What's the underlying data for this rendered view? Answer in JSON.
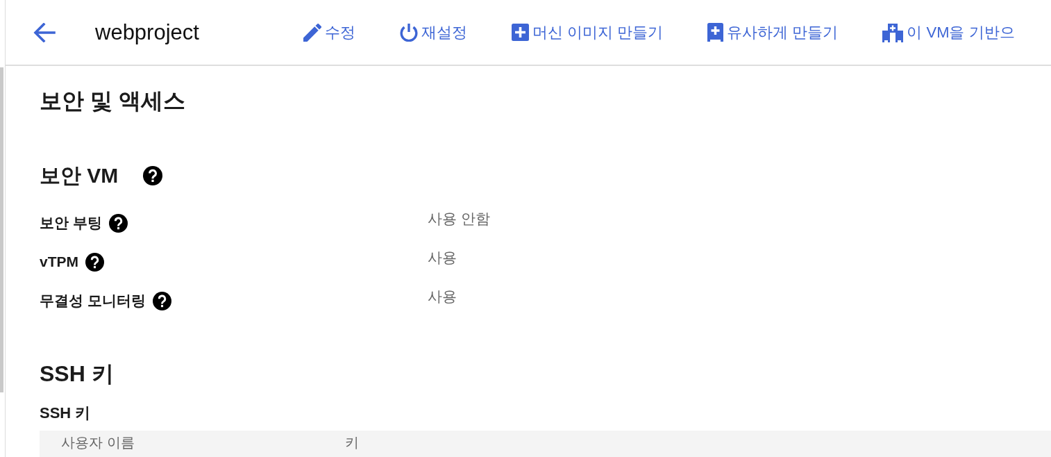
{
  "header": {
    "title": "webproject"
  },
  "toolbar": [
    {
      "label": "수정",
      "kind": "edit"
    },
    {
      "label": "재설정",
      "kind": "reset"
    },
    {
      "label": "머신 이미지 만들기",
      "kind": "machine-image"
    },
    {
      "label": "유사하게 만들기",
      "kind": "clone"
    },
    {
      "label": "이 VM을 기반으",
      "kind": "group"
    }
  ],
  "section": {
    "title": "보안 및 액세스"
  },
  "shielded_vm": {
    "title": "보안 VM",
    "properties": [
      {
        "label": "보안 부팅",
        "value": "사용 안함"
      },
      {
        "label": "vTPM",
        "value": "사용"
      },
      {
        "label": "무결성 모니터링",
        "value": "사용"
      }
    ]
  },
  "ssh_keys": {
    "title": "SSH 키",
    "subtitle": "SSH 키",
    "table": {
      "columns": [
        "사용자 이름",
        "키"
      ]
    }
  }
}
